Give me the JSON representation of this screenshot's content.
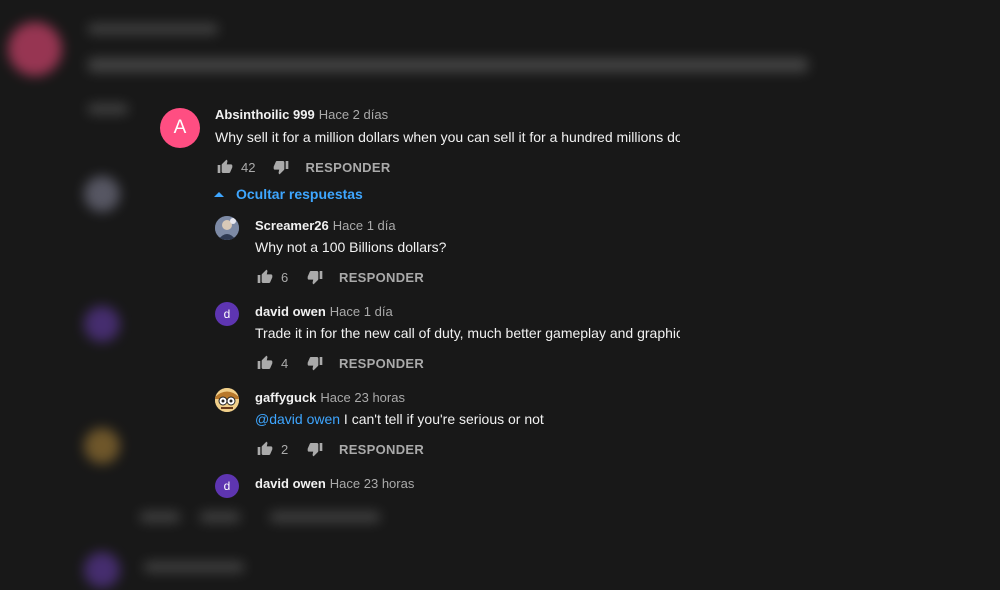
{
  "comments": {
    "main": {
      "avatar_letter": "A",
      "avatar_color": "#ff4e82",
      "author": "Absinthoilic 999",
      "time": "Hace 2 días",
      "text": "Why sell it for a million dollars when you can sell it for a hundred millions dollars?",
      "likes": "42",
      "reply_label": "RESPONDER"
    },
    "toggle_label": "Ocultar respuestas",
    "replies": [
      {
        "avatar_type": "image",
        "author": "Screamer26",
        "time": "Hace 1 día",
        "text": "Why not a 100 Billions dollars?",
        "likes": "6",
        "reply_label": "RESPONDER"
      },
      {
        "avatar_letter": "d",
        "avatar_color": "#5e35b1",
        "author": "david owen",
        "time": "Hace 1 día",
        "text": "Trade it in for the new call of duty, much better gameplay and graphics.",
        "likes": "4",
        "reply_label": "RESPONDER"
      },
      {
        "avatar_type": "image",
        "author": "gaffyguck",
        "time": "Hace 23 horas",
        "mention": "@david owen",
        "text": " I can't tell if you're serious or not",
        "likes": "2",
        "reply_label": "RESPONDER"
      },
      {
        "avatar_letter": "d",
        "avatar_color": "#5e35b1",
        "author": "david owen",
        "time": "Hace 23 horas"
      }
    ]
  },
  "colors": {
    "accent": "#3ea6ff",
    "text_primary": "#f1f1f1",
    "text_secondary": "#aaaaaa",
    "background": "#181818"
  },
  "icons": {
    "like": "thumbs-up-icon",
    "dislike": "thumbs-down-icon",
    "toggle": "caret-up-icon"
  }
}
